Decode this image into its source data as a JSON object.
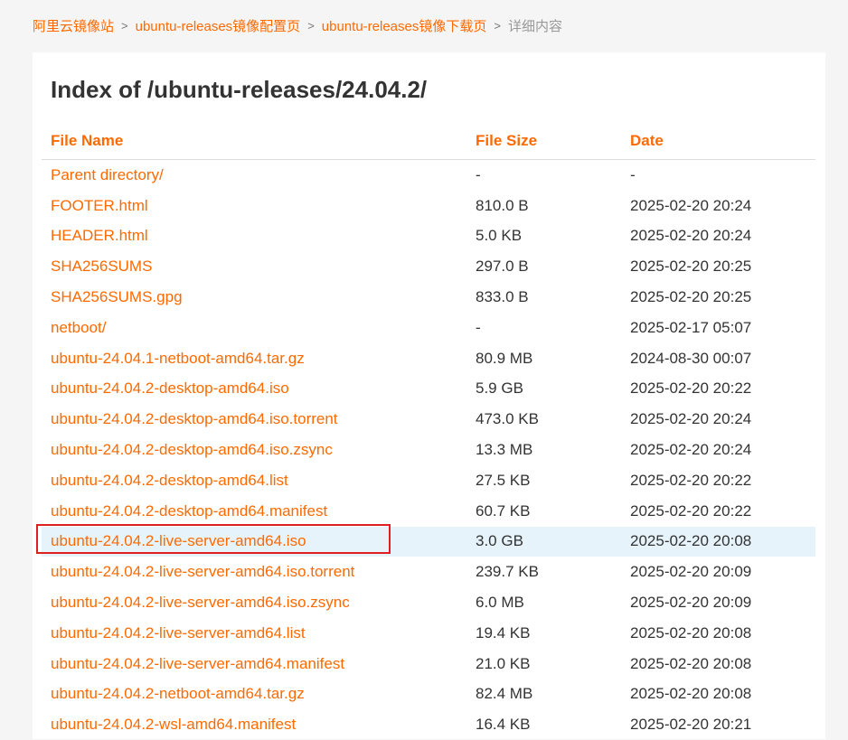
{
  "breadcrumb": {
    "items": [
      "阿里云镜像站",
      "ubuntu-releases镜像配置页",
      "ubuntu-releases镜像下载页"
    ],
    "separator": ">",
    "current": "详细内容"
  },
  "page": {
    "title": "Index of /ubuntu-releases/24.04.2/"
  },
  "table": {
    "headers": {
      "name": "File Name",
      "size": "File Size",
      "date": "Date"
    },
    "highlighted_index": 12,
    "rows": [
      {
        "name": "Parent directory/",
        "size": "-",
        "date": "-"
      },
      {
        "name": "FOOTER.html",
        "size": "810.0 B",
        "date": "2025-02-20 20:24"
      },
      {
        "name": "HEADER.html",
        "size": "5.0 KB",
        "date": "2025-02-20 20:24"
      },
      {
        "name": "SHA256SUMS",
        "size": "297.0 B",
        "date": "2025-02-20 20:25"
      },
      {
        "name": "SHA256SUMS.gpg",
        "size": "833.0 B",
        "date": "2025-02-20 20:25"
      },
      {
        "name": "netboot/",
        "size": "-",
        "date": "2025-02-17 05:07"
      },
      {
        "name": "ubuntu-24.04.1-netboot-amd64.tar.gz",
        "size": "80.9 MB",
        "date": "2024-08-30 00:07"
      },
      {
        "name": "ubuntu-24.04.2-desktop-amd64.iso",
        "size": "5.9 GB",
        "date": "2025-02-20 20:22"
      },
      {
        "name": "ubuntu-24.04.2-desktop-amd64.iso.torrent",
        "size": "473.0 KB",
        "date": "2025-02-20 20:24"
      },
      {
        "name": "ubuntu-24.04.2-desktop-amd64.iso.zsync",
        "size": "13.3 MB",
        "date": "2025-02-20 20:24"
      },
      {
        "name": "ubuntu-24.04.2-desktop-amd64.list",
        "size": "27.5 KB",
        "date": "2025-02-20 20:22"
      },
      {
        "name": "ubuntu-24.04.2-desktop-amd64.manifest",
        "size": "60.7 KB",
        "date": "2025-02-20 20:22"
      },
      {
        "name": "ubuntu-24.04.2-live-server-amd64.iso",
        "size": "3.0 GB",
        "date": "2025-02-20 20:08"
      },
      {
        "name": "ubuntu-24.04.2-live-server-amd64.iso.torrent",
        "size": "239.7 KB",
        "date": "2025-02-20 20:09"
      },
      {
        "name": "ubuntu-24.04.2-live-server-amd64.iso.zsync",
        "size": "6.0 MB",
        "date": "2025-02-20 20:09"
      },
      {
        "name": "ubuntu-24.04.2-live-server-amd64.list",
        "size": "19.4 KB",
        "date": "2025-02-20 20:08"
      },
      {
        "name": "ubuntu-24.04.2-live-server-amd64.manifest",
        "size": "21.0 KB",
        "date": "2025-02-20 20:08"
      },
      {
        "name": "ubuntu-24.04.2-netboot-amd64.tar.gz",
        "size": "82.4 MB",
        "date": "2025-02-20 20:08"
      },
      {
        "name": "ubuntu-24.04.2-wsl-amd64.manifest",
        "size": "16.4 KB",
        "date": "2025-02-20 20:21"
      }
    ]
  },
  "colors": {
    "accent": "#ff6a00",
    "highlight_row": "#e6f3fb",
    "selection_border": "#e02020"
  }
}
